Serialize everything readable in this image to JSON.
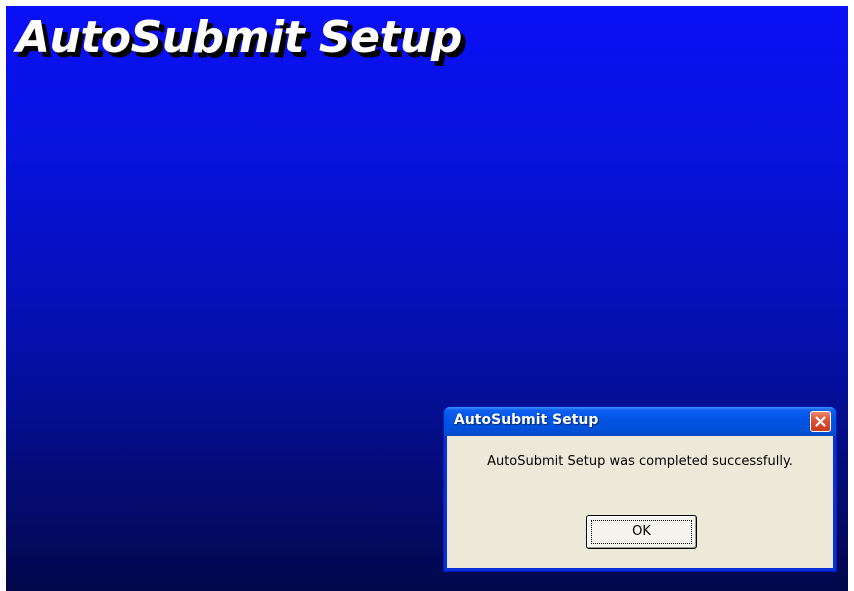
{
  "background": {
    "title": "AutoSubmit Setup",
    "gradient_top": "#0a10f6",
    "gradient_bottom": "#03074a"
  },
  "dialog": {
    "title": "AutoSubmit Setup",
    "message": "AutoSubmit Setup was completed successfully.",
    "ok_label": "OK",
    "close_icon": "close-icon",
    "titlebar_color": "#0054e3",
    "body_color": "#ece9d8"
  }
}
